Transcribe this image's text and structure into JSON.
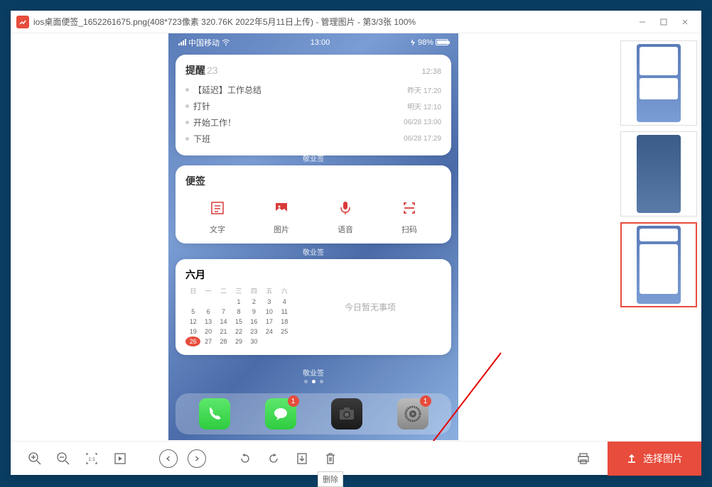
{
  "title": "ios桌面便签_1652261675.png(408*723像素 320.76K 2022年5月11日上传) - 管理图片 - 第3/3张 100%",
  "phone": {
    "carrier": "中国移动",
    "clock": "13:00",
    "battery": "98%",
    "reminders": {
      "title": "提醒",
      "count": "23",
      "head_time": "12:38",
      "items": [
        {
          "text": "【延迟】工作总结",
          "when": "昨天 17:20"
        },
        {
          "text": "打针",
          "when": "明天 12:10"
        },
        {
          "text": "开始工作！",
          "when": "06/28 13:00"
        },
        {
          "text": "下班",
          "when": "06/28 17:29"
        }
      ]
    },
    "applabel": "敬业签",
    "notes": {
      "title": "便签",
      "items": [
        "文字",
        "图片",
        "语音",
        "扫码"
      ]
    },
    "calendar": {
      "title": "六月",
      "weekdays": [
        "日",
        "一",
        "二",
        "三",
        "四",
        "五",
        "六"
      ],
      "empty_text": "今日暂无事项",
      "today": 26
    },
    "dock_badges": {
      "msg": "1",
      "set": "1"
    }
  },
  "toolbar": {
    "delete_tooltip": "删除",
    "select": "选择图片"
  }
}
